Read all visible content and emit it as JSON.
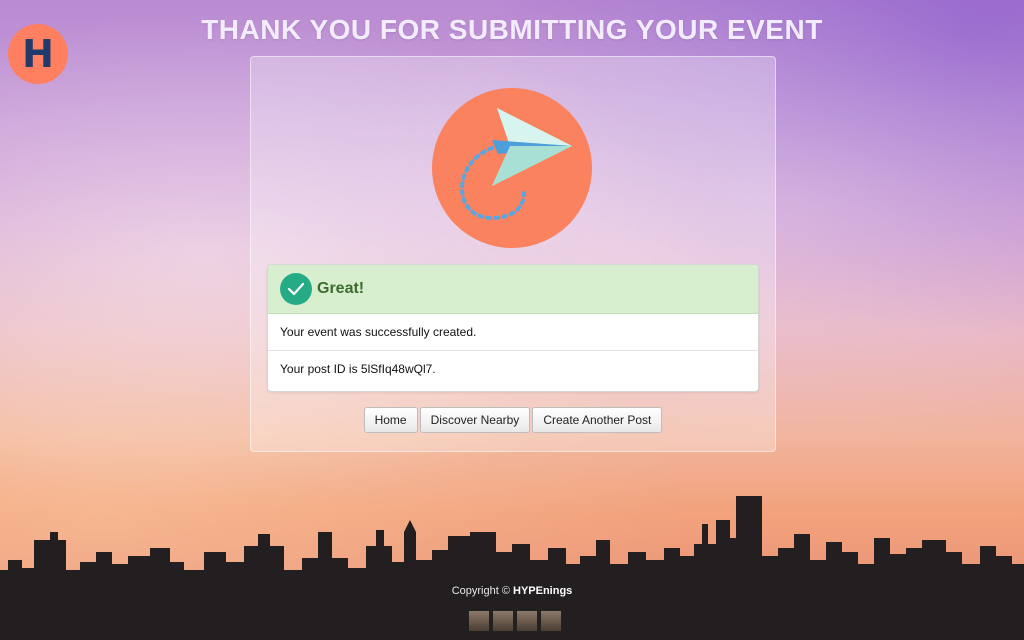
{
  "page": {
    "title": "THANK YOU FOR SUBMITTING YOUR EVENT",
    "logo_letter": "H"
  },
  "alert": {
    "heading": "Great!",
    "message": "Your event was successfully created.",
    "post_id_text": "Your post ID is 5lSfIq48wQl7."
  },
  "buttons": {
    "home": "Home",
    "discover": "Discover Nearby",
    "create": "Create Another Post"
  },
  "footer": {
    "copyright_prefix": "Copyright ©",
    "brand": "HYPEnings",
    "team_members": 4
  },
  "icons": {
    "hero": "paper-plane-icon",
    "alert": "checkmark-icon"
  },
  "colors": {
    "accent_orange": "#fa825f",
    "success_green": "#26ab87",
    "alert_bg": "#d8efcf",
    "logo_text": "#1f3a6b"
  }
}
